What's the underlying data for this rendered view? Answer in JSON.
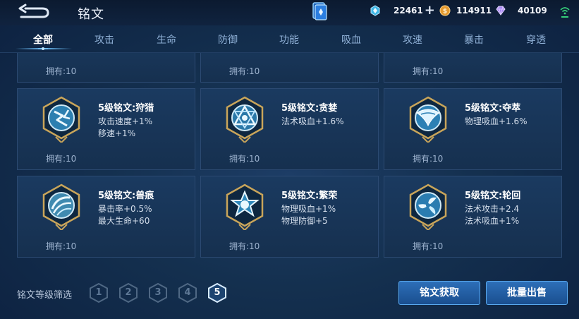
{
  "header": {
    "title": "铭文"
  },
  "currencies": [
    {
      "name": "diamond-icon",
      "value": "22461",
      "color": "#4fc3e8"
    },
    {
      "name": "gold-coin-icon",
      "value": "114911",
      "color": "#e9a23a"
    },
    {
      "name": "gem-icon",
      "value": "40109",
      "color": "#b99cff"
    }
  ],
  "tabs": [
    "全部",
    "攻击",
    "生命",
    "防御",
    "功能",
    "吸血",
    "攻速",
    "暴击",
    "穿透"
  ],
  "active_tab": 0,
  "top_row_owned": [
    "拥有:10",
    "拥有:10",
    "拥有:10"
  ],
  "inscriptions": [
    {
      "name": "5级铭文:狩猎",
      "stats": [
        "攻击速度+1%",
        "移速+1%"
      ],
      "owned": "拥有:10",
      "icon": "hunt-emblem-icon"
    },
    {
      "name": "5级铭文:贪婪",
      "stats": [
        "法术吸血+1.6%"
      ],
      "owned": "拥有:10",
      "icon": "greed-emblem-icon"
    },
    {
      "name": "5级铭文:夺萃",
      "stats": [
        "物理吸血+1.6%"
      ],
      "owned": "拥有:10",
      "icon": "extract-emblem-icon"
    },
    {
      "name": "5级铭文:兽痕",
      "stats": [
        "暴击率+0.5%",
        "最大生命+60"
      ],
      "owned": "拥有:10",
      "icon": "beast-mark-emblem-icon"
    },
    {
      "name": "5级铭文:繁荣",
      "stats": [
        "物理吸血+1%",
        "物理防御+5"
      ],
      "owned": "拥有:10",
      "icon": "prosper-emblem-icon"
    },
    {
      "name": "5级铭文:轮回",
      "stats": [
        "法术攻击+2.4",
        "法术吸血+1%"
      ],
      "owned": "拥有:10",
      "icon": "reincarnation-emblem-icon"
    }
  ],
  "filter": {
    "label": "铭文等级筛选",
    "levels": [
      "1",
      "2",
      "3",
      "4",
      "5"
    ],
    "selected": "5"
  },
  "buttons": {
    "acquire": "铭文获取",
    "bulk_sell": "批量出售"
  }
}
